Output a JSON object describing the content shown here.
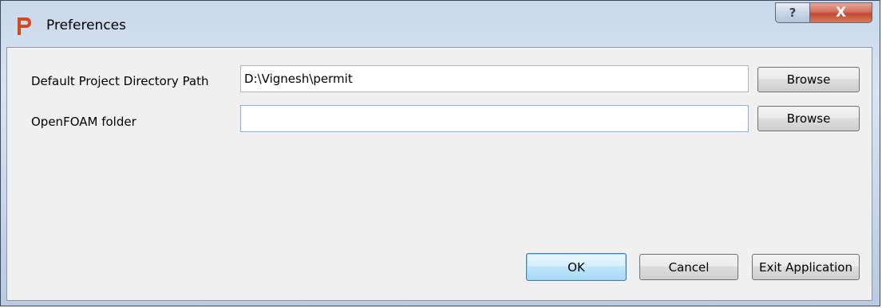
{
  "window": {
    "title": "Preferences",
    "help_glyph": "?",
    "close_glyph": "X"
  },
  "form": {
    "project_dir": {
      "label": "Default Project Directory Path",
      "value": "D:\\Vignesh\\permit",
      "browse_label": "Browse"
    },
    "openfoam": {
      "label": "OpenFOAM folder",
      "value": "",
      "browse_label": "Browse"
    }
  },
  "footer": {
    "ok_label": "OK",
    "cancel_label": "Cancel",
    "exit_label": "Exit Application"
  },
  "colors": {
    "accent": "#d54a22",
    "close_button": "#c04a32",
    "default_button": "#bee6fd"
  },
  "icons": {
    "app": "app-logo-icon",
    "help": "help-icon",
    "close": "close-icon"
  }
}
